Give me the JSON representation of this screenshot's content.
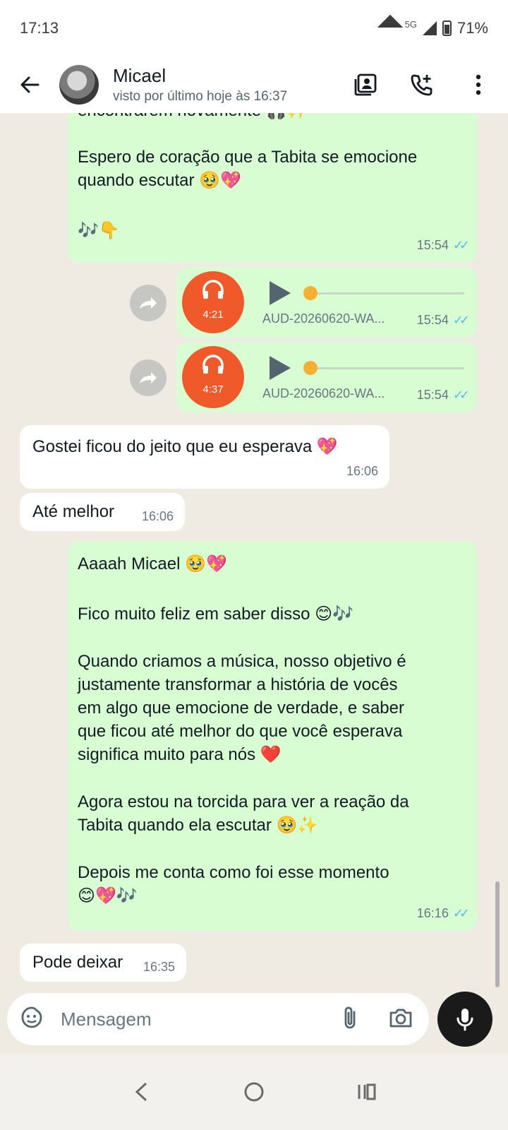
{
  "status_bar": {
    "time": "17:13",
    "network": "5G",
    "battery": "71%"
  },
  "header": {
    "contact_name": "Micael",
    "last_seen": "visto por último hoje às 16:37"
  },
  "messages": [
    {
      "type": "text",
      "direction": "out",
      "lines": [
        "encontrarem novamente 🎧✨",
        "Espero de coração que a Tabita se emocione",
        "quando escutar 🥹💖",
        "🎶👇"
      ],
      "time": "15:54",
      "read": true
    },
    {
      "type": "audio",
      "direction": "out",
      "duration": "4:21",
      "filename": "AUD-20260620-WA...",
      "time": "15:54",
      "read": true
    },
    {
      "type": "audio",
      "direction": "out",
      "duration": "4:37",
      "filename": "AUD-20260620-WA...",
      "time": "15:54",
      "read": true
    },
    {
      "type": "text",
      "direction": "in",
      "text": "Gostei ficou do jeito que eu esperava 💖",
      "time": "16:06"
    },
    {
      "type": "text",
      "direction": "in",
      "text": "Até melhor",
      "time": "16:06"
    },
    {
      "type": "text",
      "direction": "out",
      "lines": [
        "Aaaah Micael 🥹💖",
        "Fico muito feliz em saber disso 😊🎶",
        "Quando criamos a música, nosso objetivo é",
        "justamente transformar a história de vocês",
        "em algo que emocione de verdade, e saber",
        "que ficou até melhor do que você esperava",
        "significa muito para nós ❤️",
        "Agora estou na torcida para ver a reação da",
        "Tabita quando ela escutar 🥹✨",
        "Depois me conta como foi esse momento",
        "😊💖🎶"
      ],
      "time": "16:16",
      "read": true
    },
    {
      "type": "text",
      "direction": "in",
      "text": "Pode deixar",
      "time": "16:35"
    }
  ],
  "input": {
    "placeholder": "Mensagem"
  },
  "icons": {
    "back": "back-arrow-icon",
    "contact_card": "contact-card-icon",
    "add_call": "add-call-icon",
    "more": "more-vert-icon",
    "sticker": "sticker-icon",
    "attach": "paperclip-icon",
    "camera": "camera-icon",
    "mic": "mic-icon",
    "play": "play-icon",
    "headphones": "headphones-icon",
    "forward": "forward-icon"
  },
  "colors": {
    "outgoing_bubble": "#d9fdd3",
    "incoming_bubble": "#ffffff",
    "chat_background": "#efeae2",
    "read_ticks": "#53bdeb",
    "audio_avatar": "#f05a2a"
  }
}
